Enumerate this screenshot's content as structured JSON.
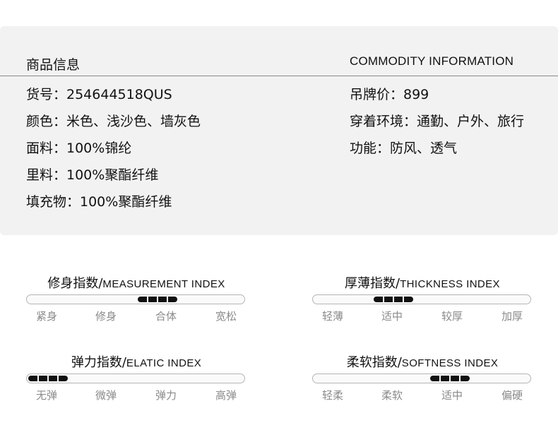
{
  "panel": {
    "title_cn": "商品信息",
    "title_en": "COMMODITY INFORMATION",
    "left_rows": [
      "货号：254644518QUS",
      "颜色：米色、浅沙色、墙灰色",
      "面料：100%锦纶",
      "里料：100%聚酯纤维",
      "填充物：100%聚酯纤维"
    ],
    "right_rows": [
      "吊牌价：899",
      "穿着环境：通勤、户外、旅行",
      "功能：防风、透气"
    ]
  },
  "indexes": [
    {
      "title_cn": "修身指数/",
      "title_en": "MEASUREMENT INDEX",
      "labels": [
        "紧身",
        "修身",
        "合体",
        "宽松"
      ],
      "level": 0.6
    },
    {
      "title_cn": "厚薄指数/",
      "title_en": "THICKNESS INDEX",
      "labels": [
        "轻薄",
        "适中",
        "较厚",
        "加厚"
      ],
      "level": 0.37
    },
    {
      "title_cn": "弹力指数/",
      "title_en": "ELATIC INDEX",
      "labels": [
        "无弹",
        "微弹",
        "弹力",
        "高弹"
      ],
      "level": 0.09
    },
    {
      "title_cn": "柔软指数/",
      "title_en": "SOFTNESS INDEX",
      "labels": [
        "轻柔",
        "柔软",
        "适中",
        "偏硬"
      ],
      "level": 0.63
    }
  ]
}
